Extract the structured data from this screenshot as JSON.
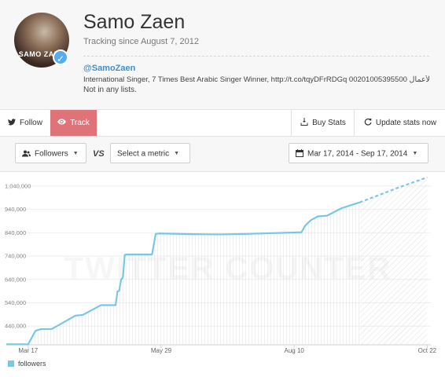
{
  "profile": {
    "name": "Samo Zaen",
    "tracking_since": "Tracking since August 7, 2012",
    "handle": "@SamoZaen",
    "bio": "International Singer, 7 Times Best Arabic Singer Winner, http://t.co/tqyDFrRDGq 00201005395500 إدارة الأعمال",
    "lists": "Not in any lists.",
    "avatar_text": "SAMO ZAEN",
    "verified_icon": "check-icon"
  },
  "toolbar": {
    "follow_label": "Follow",
    "track_label": "Track",
    "buy_stats_label": "Buy Stats",
    "update_stats_label": "Update stats now"
  },
  "controls": {
    "metric_label": "Followers",
    "vs_label": "VS",
    "compare_label": "Select a metric",
    "date_range_label": "Mar 17, 2014 - Sep 17, 2014"
  },
  "colors": {
    "accent": "#3d8fd1",
    "track_bg": "#e07378",
    "series": "#7ac7e3"
  },
  "chart_data": {
    "type": "area",
    "y_ticks": [
      "440,000",
      "540,000",
      "640,000",
      "740,000",
      "840,000",
      "940,000",
      "1,040,000"
    ],
    "x_ticks": [
      "Mar 17",
      "May 29",
      "Aug 10",
      "Oct 22"
    ],
    "watermark": "TWITTER COUNTER",
    "ylim": [
      360000,
      1080000
    ],
    "xlim": [
      "2014-03-05",
      "2014-10-24"
    ],
    "series": [
      {
        "name": "followers",
        "type": "actual",
        "points": [
          [
            "2014-03-05",
            362000
          ],
          [
            "2014-03-17",
            362000
          ],
          [
            "2014-03-21",
            420000
          ],
          [
            "2014-03-24",
            427000
          ],
          [
            "2014-03-30",
            428000
          ],
          [
            "2014-04-12",
            485000
          ],
          [
            "2014-04-16",
            488000
          ],
          [
            "2014-04-26",
            530000
          ],
          [
            "2014-05-04",
            530000
          ],
          [
            "2014-05-05",
            588000
          ],
          [
            "2014-05-06",
            592000
          ],
          [
            "2014-05-07",
            640000
          ],
          [
            "2014-05-08",
            648000
          ],
          [
            "2014-05-09",
            745000
          ],
          [
            "2014-05-10",
            747000
          ],
          [
            "2014-05-24",
            747000
          ],
          [
            "2014-05-26",
            835000
          ],
          [
            "2014-05-28",
            837000
          ],
          [
            "2014-06-15",
            834000
          ],
          [
            "2014-06-30",
            833000
          ],
          [
            "2014-07-15",
            835000
          ],
          [
            "2014-08-14",
            842000
          ],
          [
            "2014-08-16",
            870000
          ],
          [
            "2014-08-19",
            893000
          ],
          [
            "2014-08-23",
            910000
          ],
          [
            "2014-08-28",
            913000
          ],
          [
            "2014-09-05",
            945000
          ],
          [
            "2014-09-12",
            963000
          ],
          [
            "2014-09-15",
            970000
          ]
        ]
      },
      {
        "name": "forecast",
        "type": "predicted",
        "points": [
          [
            "2014-09-15",
            970000
          ],
          [
            "2014-09-25",
            1000000
          ],
          [
            "2014-10-05",
            1030000
          ],
          [
            "2014-10-15",
            1058000
          ],
          [
            "2014-10-22",
            1077000
          ]
        ]
      }
    ]
  },
  "legend": {
    "label": "followers"
  }
}
